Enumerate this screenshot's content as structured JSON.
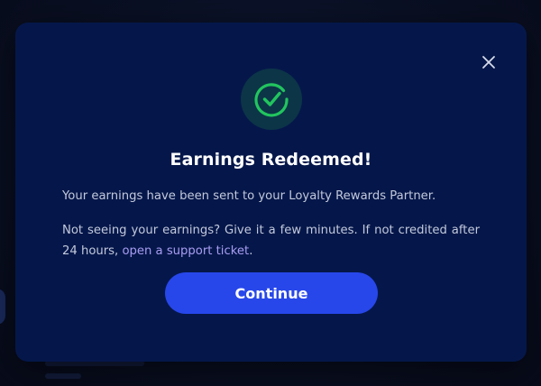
{
  "modal": {
    "title": "Earnings Redeemed!",
    "message_1": "Your earnings have been sent to your Loyalty Rewards Partner.",
    "message_2_prefix": "Not seeing your earnings? Give it a few minutes. If not credited after 24 hours, ",
    "support_link": "open a support ticket",
    "message_2_suffix": ".",
    "continue_label": "Continue",
    "icons": {
      "close": "close-icon",
      "success": "check-circle-icon"
    }
  },
  "colors": {
    "modal_background": "#05174a",
    "page_background": "#090f22",
    "accent_button": "#2747ea",
    "success_green": "#22c55e",
    "link": "#a99df3"
  }
}
